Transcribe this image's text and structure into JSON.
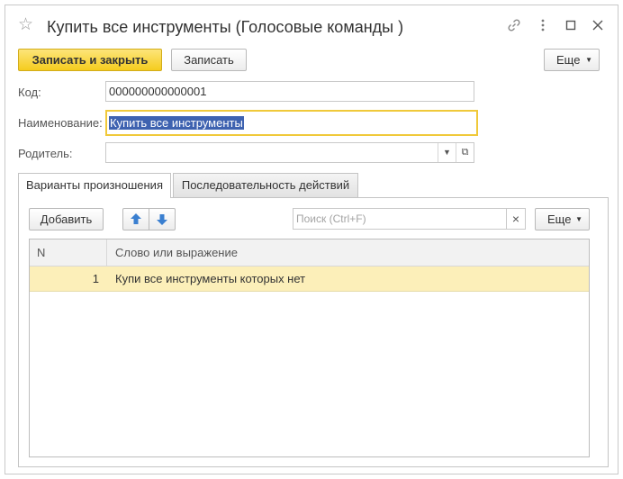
{
  "window": {
    "title": "Купить все инструменты (Голосовые команды )",
    "icons": [
      "star-icon",
      "link-icon",
      "more-icon",
      "maximize-icon",
      "close-icon"
    ]
  },
  "toolbar": {
    "save_close_label": "Записать и закрыть",
    "save_label": "Записать",
    "more_label": "Еще"
  },
  "form": {
    "code_label": "Код:",
    "code_value": "000000000000001",
    "name_label": "Наименование:",
    "name_value": "Купить все инструменты",
    "parent_label": "Родитель:",
    "parent_value": ""
  },
  "tabs": [
    {
      "label": "Варианты произношения",
      "active": true
    },
    {
      "label": "Последовательность действий",
      "active": false
    }
  ],
  "tab_toolbar": {
    "add_label": "Добавить",
    "search_placeholder": "Поиск (Ctrl+F)",
    "clear_glyph": "×",
    "more_label": "Еще"
  },
  "table": {
    "columns": [
      "N",
      "Слово или выражение"
    ],
    "rows": [
      {
        "n": "1",
        "text": "Купи все инструменты которых нет"
      }
    ]
  },
  "colors": {
    "primary_button": "#f5cc1e",
    "focus_border": "#f0c93a",
    "selected_row": "#fcefb9",
    "text_selection": "#3e62b0",
    "arrow_blue": "#3a7fd0"
  }
}
